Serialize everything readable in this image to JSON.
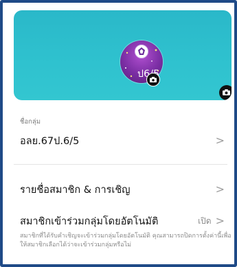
{
  "cover": {
    "background_color": "#2ab8c9",
    "avatar_text": "ป6/5",
    "avatar_icon": "camera-icon",
    "cover_icon": "camera-icon"
  },
  "group_name": {
    "label": "ชื่อกลุ่ม",
    "value": "อลย.67ป.6/5",
    "chevron": ">"
  },
  "members": {
    "label": "รายชื่อสมาชิก & การเชิญ",
    "chevron": ">"
  },
  "auto_join": {
    "label": "สมาชิกเข้าร่วมกลุ่มโดยอัตโนมัติ",
    "status": "เปิด",
    "chevron": ">",
    "description": "สมาชิกที่ได้รับคำเชิญจะเข้าร่วมกลุ่มโดยอัตโนมัติ คุณสามารถปิดการตั้งค่านี้เพื่อให้สมาชิกเลือกได้ว่าจะเข้าร่วมกลุ่มหรือไม่"
  }
}
